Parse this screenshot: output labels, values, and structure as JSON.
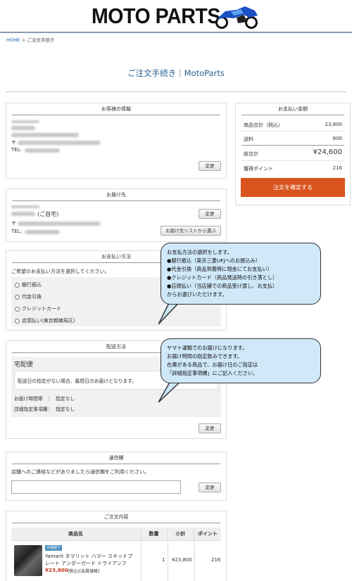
{
  "logo": {
    "text": "MOTO PARTS"
  },
  "breadcrumb": {
    "home": "HOME",
    "separator": ">",
    "current": "ご注文手続き"
  },
  "page_title": "ご注文手続き｜MotoParts",
  "customer": {
    "title": "お客様の情報",
    "tel_label": "TEL:",
    "postal_prefix": "〒",
    "change_label": "変更"
  },
  "delivery": {
    "title": "お届け先",
    "name_suffix": "(ご自宅)",
    "postal_prefix": "〒",
    "tel_label": "TEL:",
    "change_label": "変更",
    "choose_label": "お届け先リストから選ぶ"
  },
  "payment": {
    "title": "お支払い方法",
    "prompt": "ご希望のお支払い方法を選択してください。",
    "options": [
      "銀行振込",
      "代金引換",
      "クレジットカード",
      "店頭払い(東京都練馬区)"
    ]
  },
  "shipping": {
    "title": "配送方法",
    "method": "宅配便",
    "note": "配送日の指定がない場合、最短日のお届けとなります。",
    "time_label": "お届け時間帯　：",
    "time_value": "指定なし",
    "detail_label": "詳細指定事項欄：",
    "detail_value": "指定なし",
    "change_label": "変更"
  },
  "comments": {
    "title": "通信欄",
    "prompt": "店舗へのご連絡などがありましたら通信欄をご利用ください。",
    "change_label": "変更"
  },
  "order": {
    "title": "ご注文内容",
    "headers": [
      "商品名",
      "数量",
      "小計",
      "ポイント"
    ],
    "item": {
      "badge": "大幅値下",
      "name_line1": "Yamarit タマリット ハマー スキッドプ",
      "name_line2": "レート アンダーガード トライアンフ",
      "price": "¥23,800",
      "price_note": "(税込)[会員価格]",
      "qty": "1",
      "subtotal": "¥23,800",
      "points": "216"
    }
  },
  "summary": {
    "title": "お支払い金額",
    "rows": [
      {
        "label": "商品合計（税込）",
        "value": "23,800"
      },
      {
        "label": "送料",
        "value": "800"
      },
      {
        "label": "総合計",
        "value": "¥24,600"
      },
      {
        "label": "獲得ポイント",
        "value": "216"
      }
    ],
    "confirm_label": "注文を確定する"
  },
  "bubble_payment": {
    "lines": [
      "お支払方法の選択をします。",
      "●銀行振込（東京三菱UFJへのお振込み）",
      "●代金引換（商品到着時に現金にてお支払い）",
      "●クレジットカード（商品発送時の引き落とし）",
      "●店頭払い（当店舗での商品受け渡し、お支払）",
      "からお選びいただけます。"
    ]
  },
  "bubble_shipping": {
    "lines": [
      "ヤマト運輸でのお届けになります。",
      "お届け時間の指定飲みできます。",
      "在庫がある商品で、お届け日のご指定は",
      "「詳細指定事項欄」にご記入ください。"
    ]
  },
  "colors": {
    "accent": "#d9541e",
    "title": "#2a5f8f",
    "bubble": "#cfe9f8",
    "logo_bike": "#1b4fc4"
  }
}
